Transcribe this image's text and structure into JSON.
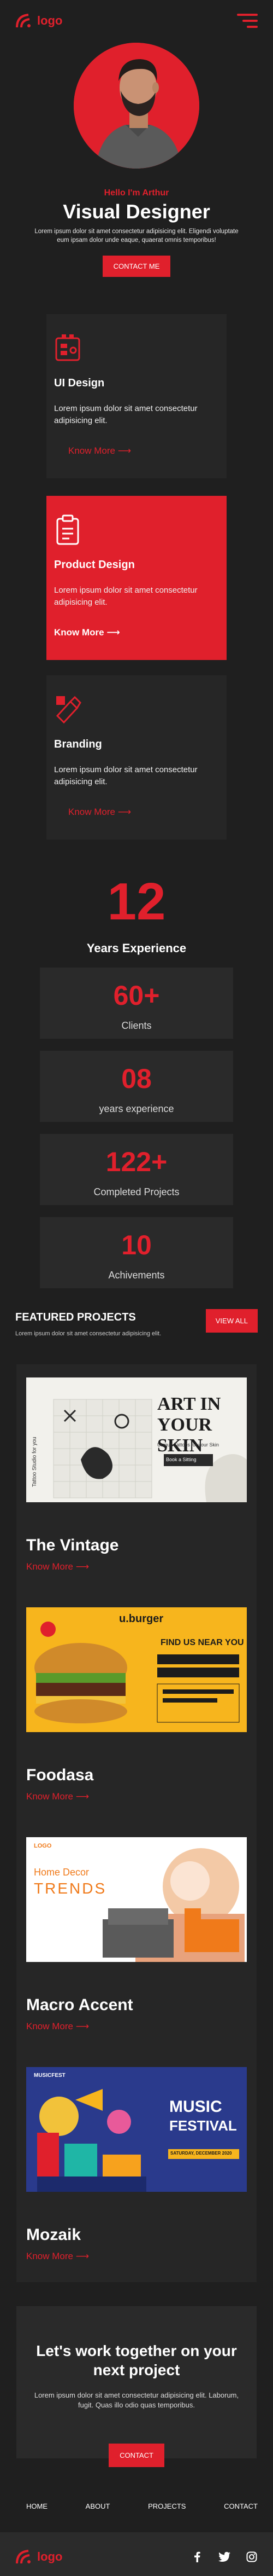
{
  "brand": {
    "logo_text": "logo",
    "accent": "#e0202c",
    "background": "#1f1f1f",
    "card": "#262626"
  },
  "header": {
    "menu_icon": "hamburger-icon"
  },
  "hero": {
    "greeting": "Hello I'm Arthur",
    "title": "Visual Designer",
    "text": "Lorem ipsum dolor sit amet consectetur adipisicing elit. Eligendi voluptate eum ipsam dolor unde eaque, quaerat omnis temporibus!",
    "button": "CONTACT ME"
  },
  "services": [
    {
      "title": "UI Design",
      "text": "Lorem ipsum dolor sit amet consectetur adipisicing elit.",
      "link": "Know More ⟶",
      "icon": "ui-design-icon"
    },
    {
      "title": "Product Design",
      "text": "Lorem ipsum dolor sit amet consectetur adipisicing elit.",
      "link": "Know More ⟶",
      "icon": "clipboard-icon"
    },
    {
      "title": "Branding",
      "text": "Lorem ipsum dolor sit amet consectetur adipisicing elit.",
      "link": "Know More ⟶",
      "icon": "branding-icon"
    }
  ],
  "experience": {
    "years": "12",
    "label": "Years Experience",
    "stats": [
      {
        "value": "60+",
        "label": "Clients"
      },
      {
        "value": "08",
        "label": "years experience"
      },
      {
        "value": "122+",
        "label": "Completed Projects"
      },
      {
        "value": "10",
        "label": "Achivements"
      }
    ]
  },
  "featured": {
    "title": "FEATURED PROJECTS",
    "subtitle": "Lorem ipsum dolor sit amet consectetur adipisicing elit.",
    "button": "VIEW ALL"
  },
  "projects": [
    {
      "title": "The Vintage",
      "link": "Know More ⟶",
      "card": {
        "headline_1": "ART IN",
        "headline_2": "YOUR SKIN",
        "vertical": "Tattoo Studio for you",
        "tag": "Unique Tattoos for your Skin",
        "button": "Book a Sitting"
      }
    },
    {
      "title": "Foodasa",
      "link": "Know More ⟶",
      "card": {
        "brand": "u.burger",
        "heading": "FIND US NEAR YOU"
      }
    },
    {
      "title": "Macro Accent",
      "link": "Know More ⟶",
      "card": {
        "brand": "LOGO",
        "line_1": "Home  Decor",
        "line_2": "TRENDS"
      }
    },
    {
      "title": "Mozaik",
      "link": "Know More ⟶",
      "card": {
        "brand": "MUSICFEST",
        "line_1": "MUSIC",
        "line_2": "FESTIVAL",
        "date": "SATURDAY, DECEMBER 2020"
      }
    }
  ],
  "cta": {
    "title": "Let's work together on your next project",
    "text": "Lorem ipsum dolor sit amet consectetur adipisicing elit. Laborum, fugit. Quas illo odio quas temporibus.",
    "button": "CONTACT"
  },
  "footer_nav": [
    "HOME",
    "ABOUT",
    "PROJECTS",
    "CONTACT"
  ],
  "footer": {
    "logo_text": "logo",
    "socials": [
      "facebook-icon",
      "twitter-icon",
      "instagram-icon"
    ]
  }
}
